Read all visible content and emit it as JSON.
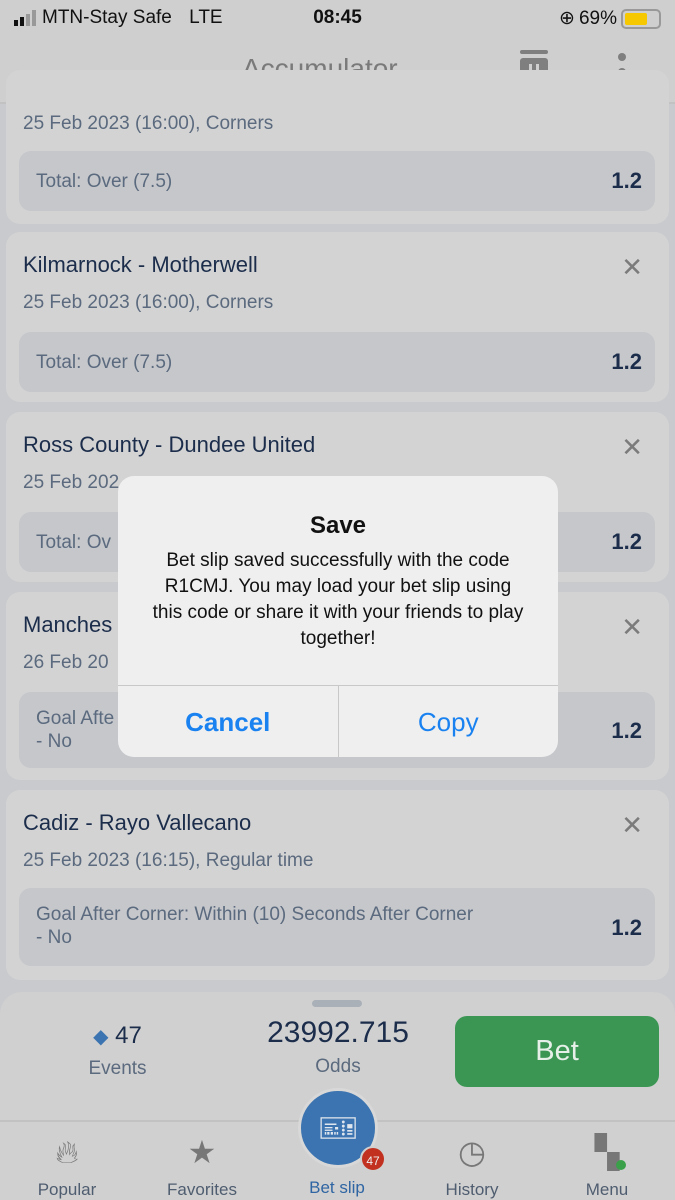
{
  "status": {
    "carrier": "MTN-Stay Safe",
    "network": "LTE",
    "time": "08:45",
    "battery": "69%",
    "battery_level": 0.69,
    "battery_color": "#f6c800"
  },
  "header": {
    "title": "Accumulator",
    "icons": [
      "chevron-down-icon",
      "trash-icon",
      "more-vertical-icon"
    ]
  },
  "cards": [
    {
      "name": "",
      "meta": "25 Feb 2023 (16:00), Corners",
      "pick": "Total: Over (7.5)",
      "pick2": "",
      "odd": "1.2"
    },
    {
      "name": "Kilmarnock - Motherwell",
      "meta": "25 Feb 2023 (16:00), Corners",
      "pick": "Total: Over (7.5)",
      "pick2": "",
      "odd": "1.2"
    },
    {
      "name": "Ross County - Dundee United",
      "meta": "25 Feb 202",
      "pick": "Total: Ov",
      "pick2": "",
      "odd": "1.2"
    },
    {
      "name": "Manches",
      "meta": "26 Feb 20",
      "pick": "Goal Afte",
      "pick2": "- No",
      "odd": "1.2"
    },
    {
      "name": "Cadiz - Rayo Vallecano",
      "meta": "25 Feb 2023 (16:15), Regular time",
      "pick": "Goal After Corner: Within (10) Seconds After Corner",
      "pick2": "- No",
      "odd": "1.2"
    }
  ],
  "summary": {
    "events_count": "47",
    "events_label": "Events",
    "odds_value": "23992.715",
    "odds_label": "Odds",
    "bet_label": "Bet",
    "bet_color": "#3b9654"
  },
  "nav": {
    "items": [
      {
        "label": "Popular",
        "icon": "flame-icon"
      },
      {
        "label": "Favorites",
        "icon": "star-icon"
      },
      {
        "label": "Bet slip",
        "icon": "ticket-icon",
        "badge": "47"
      },
      {
        "label": "History",
        "icon": "clock-icon"
      },
      {
        "label": "Menu",
        "icon": "grid-icon"
      }
    ]
  },
  "dialog": {
    "title": "Save",
    "message": "Bet slip saved successfully with the code R1CMJ. You may load your bet slip using this code or share it with your friends to play together!",
    "cancel": "Cancel",
    "copy": "Copy",
    "accent": "#1a82f0"
  }
}
